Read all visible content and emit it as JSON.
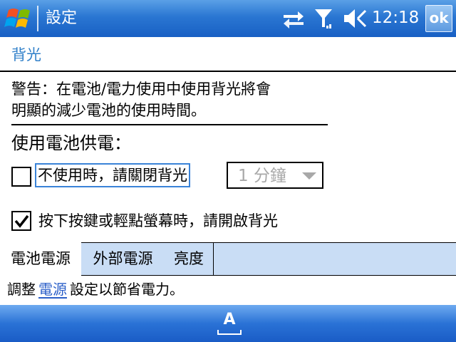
{
  "titlebar": {
    "app_title": "設定",
    "clock": "12:18",
    "ok_label": "ok",
    "icons": [
      "windows-start-flag",
      "connectivity-arrows",
      "signal-antenna",
      "volume-speaker"
    ]
  },
  "page": {
    "title": "背光"
  },
  "warning": {
    "line1": "警告：在電池/電力使用中使用背光將會",
    "line2": "明顯的減少電池的使用時間。"
  },
  "battery": {
    "heading": "使用電池供電：",
    "turn_off": {
      "label": "不使用時，請關閉背光",
      "checked": false
    },
    "timeout": {
      "value": "1 分鐘",
      "enabled": false
    },
    "turn_on": {
      "label": "按下按鍵或輕點螢幕時，請開啟背光",
      "checked": true
    }
  },
  "tabs": [
    {
      "label": "電池電源",
      "active": true
    },
    {
      "label": "外部電源",
      "active": false
    },
    {
      "label": "亮度",
      "active": false
    }
  ],
  "footer": {
    "prefix": "調整",
    "link": "電源",
    "suffix": "設定以節省電力。"
  },
  "bottom_bar": {
    "sip_label": "A"
  },
  "colors": {
    "titlebar_blue": "#2a76d2",
    "page_title": "#2f7fc9",
    "focus_outline": "#3a83d8",
    "tab_inactive_bg": "#c9ddf5",
    "link": "#2a5ec8",
    "disabled_text": "#a8a8a8"
  }
}
